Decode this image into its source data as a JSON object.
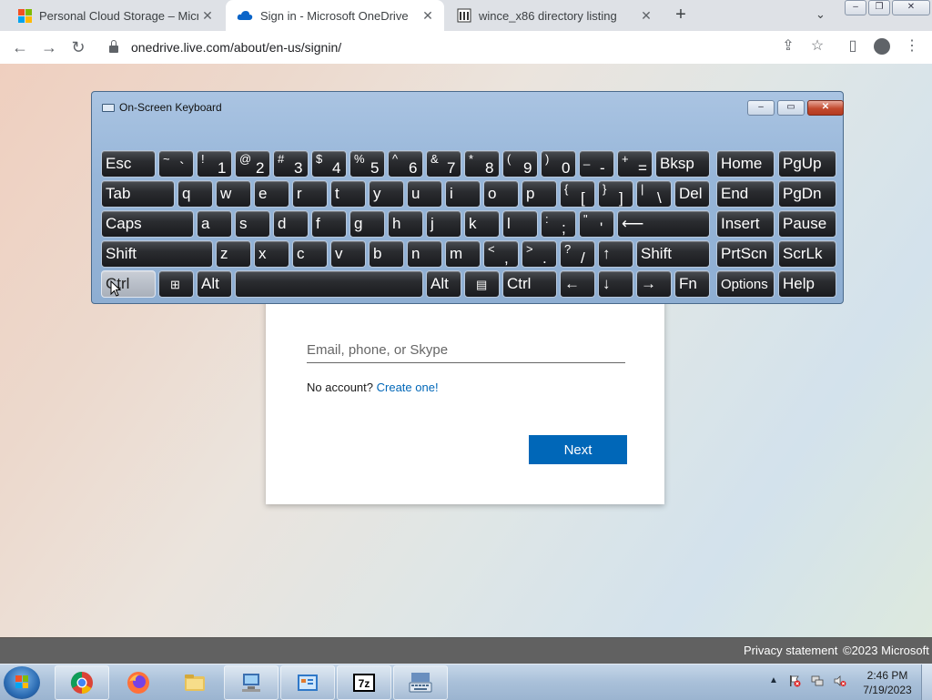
{
  "browser": {
    "tabs": [
      {
        "title": "Personal Cloud Storage – Micros",
        "icon": "microsoft-logo-icon",
        "active": false
      },
      {
        "title": "Sign in - Microsoft OneDrive",
        "icon": "onedrive-cloud-icon",
        "active": true
      },
      {
        "title": "wince_x86 directory listing",
        "icon": "library-building-icon",
        "active": false
      }
    ],
    "new_tab_label": "+",
    "url": "onedrive.live.com/about/en-us/signin/"
  },
  "signin": {
    "email_placeholder": "Email, phone, or Skype",
    "email_value": "",
    "no_account_text": "No account?",
    "create_link": "Create one!",
    "next_label": "Next"
  },
  "footer": {
    "privacy": "Privacy statement",
    "copyright": "©2023 Microsoft"
  },
  "osk": {
    "title": "On-Screen Keyboard",
    "rows": [
      [
        {
          "label": "Esc"
        },
        {
          "shift": "~",
          "main": "`"
        },
        {
          "shift": "!",
          "main": "1"
        },
        {
          "shift": "@",
          "main": "2"
        },
        {
          "shift": "#",
          "main": "3"
        },
        {
          "shift": "$",
          "main": "4"
        },
        {
          "shift": "%",
          "main": "5"
        },
        {
          "shift": "^",
          "main": "6"
        },
        {
          "shift": "&",
          "main": "7"
        },
        {
          "shift": "*",
          "main": "8"
        },
        {
          "shift": "(",
          "main": "9"
        },
        {
          "shift": ")",
          "main": "0"
        },
        {
          "shift": "_",
          "main": "-"
        },
        {
          "shift": "+",
          "main": "="
        },
        {
          "label": "Bksp"
        },
        {
          "label": "Home"
        },
        {
          "label": "PgUp"
        }
      ],
      [
        {
          "label": "Tab"
        },
        {
          "label": "q"
        },
        {
          "label": "w"
        },
        {
          "label": "e"
        },
        {
          "label": "r"
        },
        {
          "label": "t"
        },
        {
          "label": "y"
        },
        {
          "label": "u"
        },
        {
          "label": "i"
        },
        {
          "label": "o"
        },
        {
          "label": "p"
        },
        {
          "shift": "{",
          "main": "["
        },
        {
          "shift": "}",
          "main": "]"
        },
        {
          "shift": "|",
          "main": "\\"
        },
        {
          "label": "Del"
        },
        {
          "label": "End"
        },
        {
          "label": "PgDn"
        }
      ],
      [
        {
          "label": "Caps"
        },
        {
          "label": "a"
        },
        {
          "label": "s"
        },
        {
          "label": "d"
        },
        {
          "label": "f"
        },
        {
          "label": "g"
        },
        {
          "label": "h"
        },
        {
          "label": "j"
        },
        {
          "label": "k"
        },
        {
          "label": "l"
        },
        {
          "shift": ":",
          "main": ";"
        },
        {
          "shift": "\"",
          "main": "'"
        },
        {
          "label": "⟵"
        },
        {
          "label": "Insert"
        },
        {
          "label": "Pause"
        }
      ],
      [
        {
          "label": "Shift"
        },
        {
          "label": "z"
        },
        {
          "label": "x"
        },
        {
          "label": "c"
        },
        {
          "label": "v"
        },
        {
          "label": "b"
        },
        {
          "label": "n"
        },
        {
          "label": "m"
        },
        {
          "shift": "<",
          "main": ","
        },
        {
          "shift": ">",
          "main": "."
        },
        {
          "shift": "?",
          "main": "/"
        },
        {
          "label": "↑"
        },
        {
          "label": "Shift"
        },
        {
          "label": "PrtScn"
        },
        {
          "label": "ScrLk"
        }
      ],
      [
        {
          "label": "Ctrl",
          "pressed": true
        },
        {
          "label": "",
          "icon": "windows-logo-icon"
        },
        {
          "label": "Alt"
        },
        {
          "label": ""
        },
        {
          "label": "Alt"
        },
        {
          "label": "",
          "icon": "menu-key-icon"
        },
        {
          "label": "Ctrl"
        },
        {
          "label": "←"
        },
        {
          "label": "↓"
        },
        {
          "label": "→"
        },
        {
          "label": "Fn"
        },
        {
          "label": "Options"
        },
        {
          "label": "Help"
        }
      ]
    ]
  },
  "taskbar": {
    "apps": [
      "chrome-icon",
      "firefox-icon",
      "file-explorer-icon",
      "network-computer-icon",
      "control-panel-icon",
      "7zip-icon",
      "on-screen-keyboard-icon"
    ],
    "time": "2:46 PM",
    "date": "7/19/2023"
  }
}
